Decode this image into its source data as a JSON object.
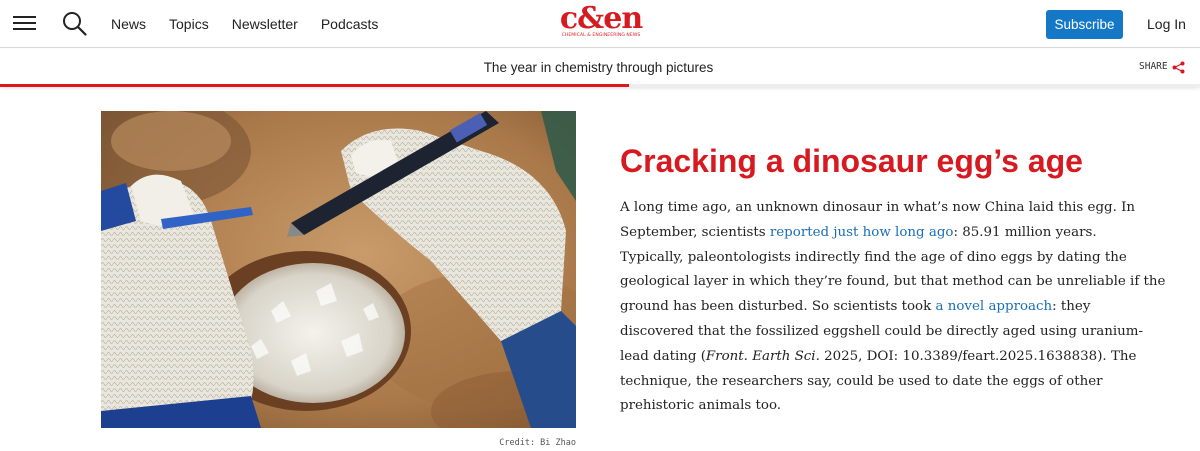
{
  "nav": {
    "links": [
      "News",
      "Topics",
      "Newsletter",
      "Podcasts"
    ],
    "subscribe_label": "Subscribe",
    "login_label": "Log In",
    "brand_color": "#d71920",
    "accent_color": "#1478c7"
  },
  "logo": {
    "main": "c&en",
    "sub": "CHEMICAL & ENGINEERING NEWS"
  },
  "storybar": {
    "title": "The year in chemistry through pictures",
    "share_label": "SHARE",
    "progress": 0.524
  },
  "photo": {
    "credit": "Credit: Bi Zhao"
  },
  "article": {
    "headline": "Cracking a dinosaur egg’s age",
    "lines": [
      [
        "A long time ago, an unknown dinosaur in what’s now China laid this egg. In"
      ],
      [
        "September, scientists ",
        {
          "link": "reported just how long ago"
        },
        ": 85.91 million years."
      ],
      [
        "Typically, paleontologists indirectly find the age of dino eggs by dating the"
      ],
      [
        "geological layer in which they’re found, but that method can be unreliable if the"
      ],
      [
        "ground has been disturbed. So scientists took ",
        {
          "link": "a novel approach"
        },
        ": they"
      ],
      [
        "discovered that the fossilized eggshell could be directly aged using uranium-"
      ],
      [
        "lead dating (",
        {
          "em": "Front. Earth Sci."
        },
        " 2025, DOI: 10.3389/feart.2025.1638838). The"
      ],
      [
        "technique, the researchers say, could be used to date the eggs of other"
      ],
      [
        "prehistoric animals too."
      ]
    ]
  }
}
